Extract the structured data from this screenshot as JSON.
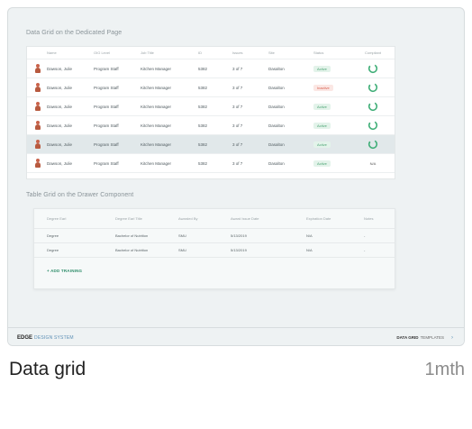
{
  "thumbnail": {
    "grid_section_title": "Data Grid on the Dedicated Page",
    "grid_columns": [
      "Name",
      "OIG Level",
      "Job Title",
      "ID",
      "Issues",
      "Site",
      "Status",
      "Compliant"
    ],
    "grid_rows": [
      {
        "name": "Dawson, Julie",
        "role": "Program Staff",
        "job": "Kitchen Manager",
        "id": "5382",
        "issue": "3 of 7",
        "site": "Dasalton",
        "status": "Active",
        "status_kind": "active",
        "compliant": "ring"
      },
      {
        "name": "Dawson, Julie",
        "role": "Program Staff",
        "job": "Kitchen Manager",
        "id": "5382",
        "issue": "3 of 7",
        "site": "Dasalton",
        "status": "Inactive",
        "status_kind": "inactive",
        "compliant": "ring"
      },
      {
        "name": "Dawson, Julie",
        "role": "Program Staff",
        "job": "Kitchen Manager",
        "id": "5382",
        "issue": "3 of 7",
        "site": "Dasalton",
        "status": "Active",
        "status_kind": "active",
        "compliant": "ring"
      },
      {
        "name": "Dawson, Julie",
        "role": "Program Staff",
        "job": "Kitchen Manager",
        "id": "5382",
        "issue": "3 of 7",
        "site": "Dasalton",
        "status": "Active",
        "status_kind": "active",
        "compliant": "ring"
      },
      {
        "name": "Dawson, Julie",
        "role": "Program Staff",
        "job": "Kitchen Manager",
        "id": "5382",
        "issue": "3 of 7",
        "site": "Dasalton",
        "status": "Active",
        "status_kind": "active",
        "compliant": "ring",
        "selected": true
      },
      {
        "name": "Dawson, Julie",
        "role": "Program Staff",
        "job": "Kitchen Manager",
        "id": "5382",
        "issue": "3 of 7",
        "site": "Dasalton",
        "status": "Active",
        "status_kind": "active",
        "compliant": "N/A"
      }
    ],
    "drawer_section_title": "Table Grid on the Drawer Component",
    "drawer_columns": [
      "Degree Earl",
      "Degree Earl Title",
      "Awarded By",
      "Award Issue Date",
      "Expiration Date",
      "Notes"
    ],
    "drawer_rows": [
      {
        "degree": "Degree",
        "title": "Bachelor of Nutrition",
        "by": "SMU",
        "date": "5/13/2019",
        "exp": "N/A",
        "notes": "-"
      },
      {
        "degree": "Degree",
        "title": "Bachelor of Nutrition",
        "by": "SMU",
        "date": "5/13/2019",
        "exp": "N/A",
        "notes": "-"
      }
    ],
    "add_training_label": "+ ADD TRAINING",
    "footer": {
      "brand_bold": "EDGE",
      "brand_light": "DESIGN SYSTEM",
      "crumb_bold": "DATA GRID",
      "crumb_light": "TEMPLATES",
      "arrow": "›"
    }
  },
  "caption": {
    "title": "Data grid",
    "time": "1mth"
  },
  "colors": {
    "ring": "#3fae77",
    "active": "#4ca474",
    "inactive": "#d8604f"
  }
}
